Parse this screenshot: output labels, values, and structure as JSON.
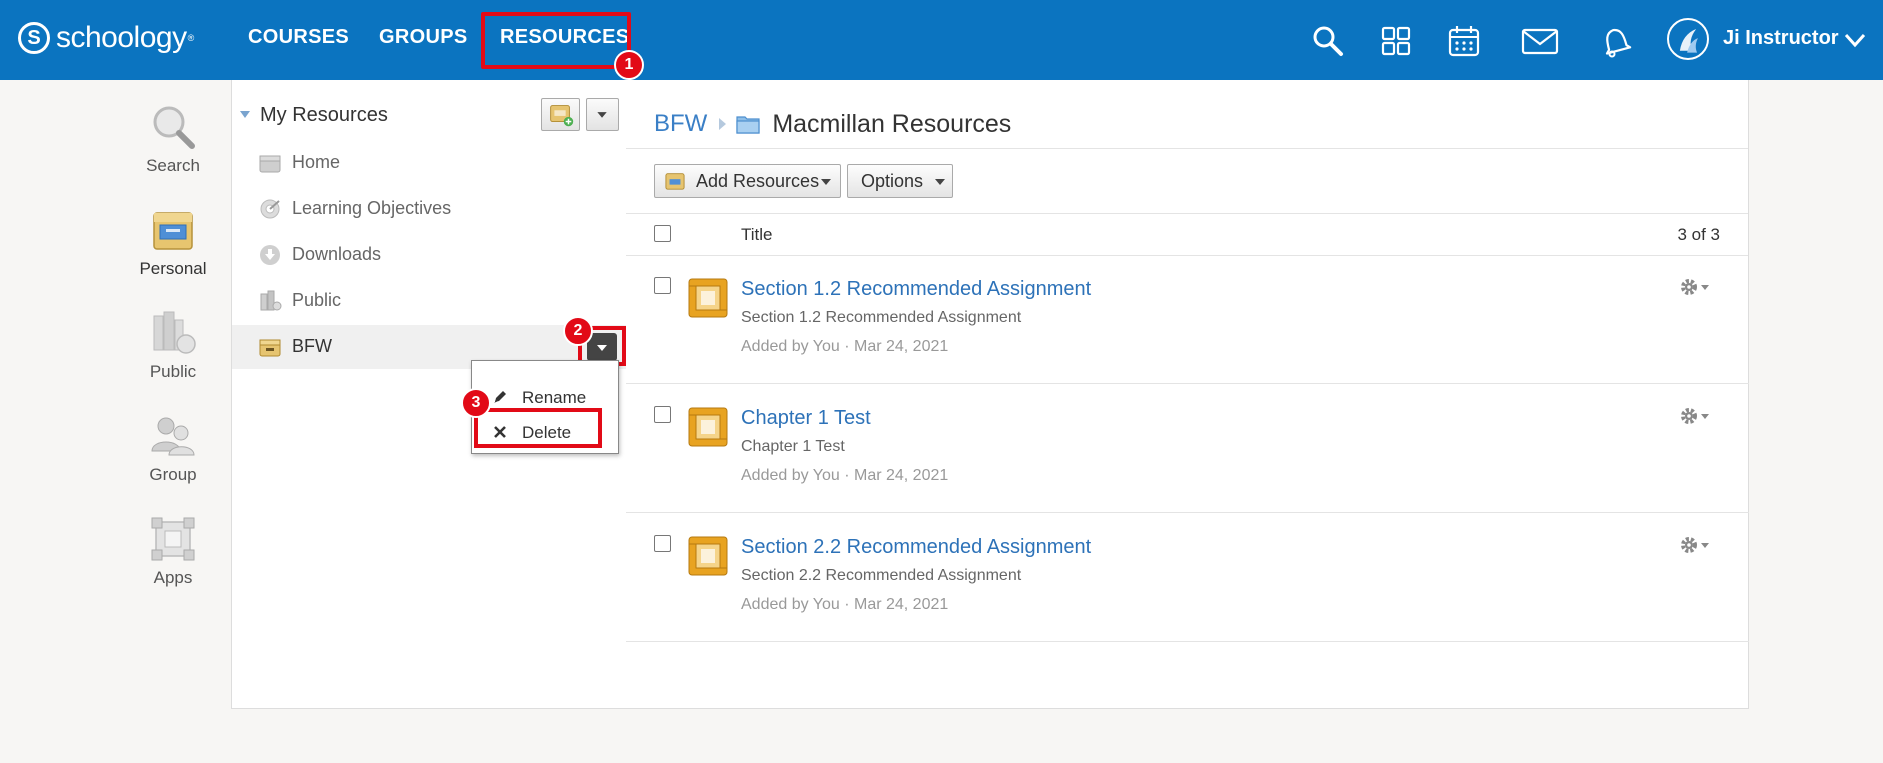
{
  "app": {
    "logo_text": "schoology",
    "logo_trademark": "®"
  },
  "nav": {
    "courses": "COURSES",
    "groups": "GROUPS",
    "resources": "RESOURCES"
  },
  "user": {
    "name": "Ji Instructor"
  },
  "annotations": {
    "step1": "1",
    "step2": "2",
    "step3": "3",
    "highlight_color": "#e20a17"
  },
  "rail": {
    "items": [
      {
        "label": "Search",
        "icon": "magnifier-icon"
      },
      {
        "label": "Personal",
        "icon": "personal-resources-icon",
        "active": true
      },
      {
        "label": "Public",
        "icon": "public-library-icon"
      },
      {
        "label": "Group",
        "icon": "group-people-icon"
      },
      {
        "label": "Apps",
        "icon": "apps-icon"
      }
    ]
  },
  "folders": {
    "title": "My Resources",
    "items": [
      {
        "label": "Home",
        "icon": "home-box-icon"
      },
      {
        "label": "Learning Objectives",
        "icon": "target-icon"
      },
      {
        "label": "Downloads",
        "icon": "download-icon"
      },
      {
        "label": "Public",
        "icon": "public-building-icon"
      },
      {
        "label": "BFW",
        "icon": "collection-box-icon",
        "selected": true
      }
    ]
  },
  "context_menu": {
    "rename": "Rename",
    "delete": "Delete"
  },
  "main": {
    "breadcrumb_root": "BFW",
    "folder_title": "Macmillan Resources",
    "add_resources": "Add Resources",
    "options": "Options",
    "column_title": "Title",
    "count": "3 of 3",
    "rows": [
      {
        "title": "Section 1.2 Recommended Assignment",
        "desc": "Section 1.2 Recommended Assignment",
        "meta": "Added by You · Mar 24, 2021"
      },
      {
        "title": "Chapter 1 Test",
        "desc": "Chapter 1 Test",
        "meta": "Added by You · Mar 24, 2021"
      },
      {
        "title": "Section 2.2 Recommended Assignment",
        "desc": "Section 2.2 Recommended Assignment",
        "meta": "Added by You · Mar 24, 2021"
      }
    ]
  },
  "colors": {
    "brand_blue": "#0b74c0",
    "link_blue": "#2d72b8",
    "assignment_gold": "#e8a321"
  }
}
